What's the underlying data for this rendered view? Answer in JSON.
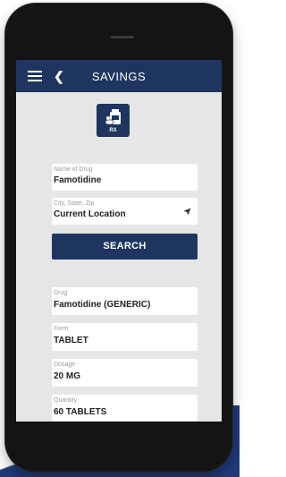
{
  "nav": {
    "title": "SAVINGS"
  },
  "badge": {
    "label": "RX"
  },
  "search_form": {
    "drug_name": {
      "label": "Name of Drug",
      "value": "Famotidine"
    },
    "location": {
      "label": "City, State, Zip",
      "value": "Current Location"
    },
    "search_label": "SEARCH"
  },
  "details": {
    "drug": {
      "label": "Drug",
      "value": "Famotidine (GENERIC)"
    },
    "form": {
      "label": "Form",
      "value": "TABLET"
    },
    "dosage": {
      "label": "Dosage",
      "value": "20 MG"
    },
    "quantity": {
      "label": "Quantity",
      "value": "60 TABLETS"
    }
  },
  "colors": {
    "primary": "#1e3560",
    "screen_bg": "#e6e6e6",
    "field_bg": "#ffffff"
  },
  "icons": [
    "hamburger-menu-icon",
    "back-chevron-icon",
    "medicine-bottle-icon",
    "location-arrow-icon"
  ]
}
